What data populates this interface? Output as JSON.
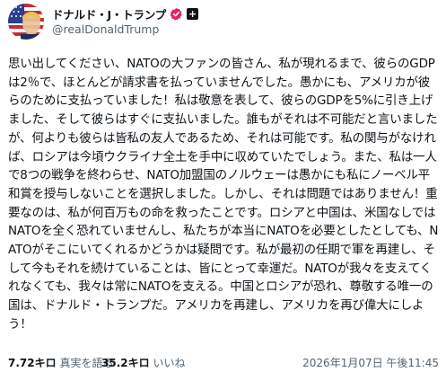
{
  "author": {
    "display_name": "ドナルド・J・トランプ",
    "handle": "@realDonaldTrump",
    "affiliation_badge": "+",
    "verified_color": "#e0245e",
    "avatar_icon": "flag-avatar-icon",
    "verified_icon": "verified-badge-icon",
    "affiliation_icon": "affiliation-badge-icon"
  },
  "post": {
    "text": "思い出してください、NATOの大ファンの皆さん、私が現れるまで、彼らのGDPは2％で、ほとんどが請求書を払っていませんでした。愚かにも、アメリカが彼らのために支払っていました！私は敬意を表して、彼らのGDPを5%に引き上げました、そして彼らはすぐに支払いました。誰もがそれは不可能だと言いましたが、何よりも彼らは皆私の友人であるため、それは可能です。私の関与がなければ、ロシアは今頃ウクライナ全土を手中に収めていたでしょう。また、私は一人で8つの戦争を終わらせ、NATO加盟国のノルウェーは愚かにも私にノーベル平和賞を授与しないことを選択しました。しかし、それは問題ではありません！重要なのは、私が何百万もの命を救ったことです。ロシアと中国は、米国なしではNATOを全く恐れていませんし、私たちが本当にNATOを必要としたとしても、NATOがそこにいてくれるかどうかは疑問です。私が最初の任期で軍を再建し、そして今もそれを続けていることは、皆にとって幸運だ。NATOが我々を支えてくれなくても、我々は常にNATOを支える。中国とロシアが恐れ、尊敬する唯一の国は、ドナルド・トランプだ。アメリカを再建し、アメリカを再び偉大にしよう！"
  },
  "stats": {
    "retruths_count": "7.72キロ",
    "retruths_label": "真実を語る",
    "likes_count": "35.2キロ",
    "likes_label": "いいね"
  },
  "timestamp": "2026年1月07日 午後11:45"
}
